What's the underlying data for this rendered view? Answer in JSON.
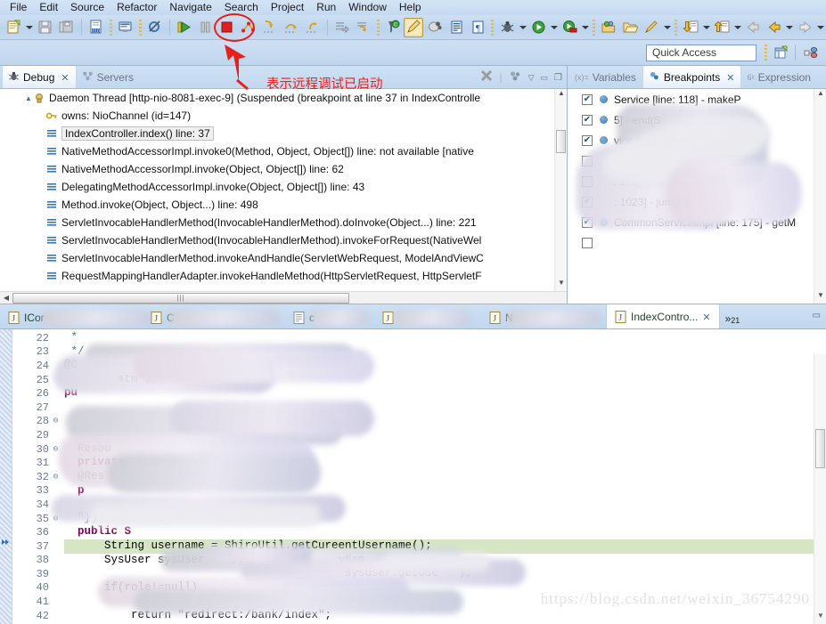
{
  "menu": {
    "items": [
      "File",
      "Edit",
      "Source",
      "Refactor",
      "Navigate",
      "Search",
      "Project",
      "Run",
      "Window",
      "Help"
    ]
  },
  "toolbar": {
    "icons": [
      "new-file-icon",
      "new-dropdown-arrow",
      "save-icon",
      "save-all-icon",
      "toggle-breakpoint-010-icon",
      "console-icon",
      "skip-all-breakpoints-icon",
      "resume-icon",
      "suspend-icon",
      "terminate-icon",
      "disconnect-icon",
      "step-into-icon",
      "step-over-icon",
      "step-return-icon",
      "run-to-line-icon",
      "drop-to-frame-icon",
      "use-step-filters-icon",
      "pencil-edit-icon",
      "toggle-mark-occurrences-icon",
      "show-whitespace-icon",
      "pilcrow-icon",
      "debug-icon",
      "debug-dropdown-arrow",
      "run-icon",
      "run-dropdown-arrow",
      "run-as-coverage-icon",
      "coverage-dropdown-arrow",
      "new-java-package-icon",
      "open-folder-icon",
      "external-tools-icon",
      "external-tools-dropdown-arrow",
      "previous-annotation-icon",
      "previous-dropdown-arrow",
      "next-annotation-icon",
      "next-dropdown-arrow",
      "back-icon",
      "back-highlight-icon",
      "back-dropdown-arrow",
      "forward-icon",
      "forward-dropdown-arrow"
    ],
    "quick_access_placeholder": "Quick Access",
    "perspective_icons": [
      "open-perspective-icon",
      "java-perspective-icon"
    ]
  },
  "debug_view": {
    "tabs": [
      {
        "label": "Debug",
        "icon": "bug-icon",
        "active": true,
        "closable": true
      },
      {
        "label": "Servers",
        "icon": "servers-icon",
        "active": false,
        "closable": false
      }
    ],
    "toolbar_icons": [
      "remove-all-terminated-icon",
      "view-menu-icon",
      "minimize-icon",
      "maximize-icon"
    ],
    "tree": [
      {
        "indent": 1,
        "twisty": "▲",
        "icon": "thread-icon",
        "label": "Daemon Thread [http-nio-8081-exec-9] (Suspended (breakpoint at line 37 in IndexControlle",
        "selected": false
      },
      {
        "indent": 2,
        "twisty": "",
        "icon": "monitor-owns-icon",
        "label": "owns: NioChannel  (id=147)",
        "selected": false
      },
      {
        "indent": 2,
        "twisty": "",
        "icon": "stack-frame-icon",
        "label": "IndexController.index() line: 37",
        "selected": true
      },
      {
        "indent": 2,
        "twisty": "",
        "icon": "stack-frame-icon",
        "label": "NativeMethodAccessorImpl.invoke0(Method, Object, Object[]) line: not available [native",
        "selected": false
      },
      {
        "indent": 2,
        "twisty": "",
        "icon": "stack-frame-icon",
        "label": "NativeMethodAccessorImpl.invoke(Object, Object[]) line: 62",
        "selected": false
      },
      {
        "indent": 2,
        "twisty": "",
        "icon": "stack-frame-icon",
        "label": "DelegatingMethodAccessorImpl.invoke(Object, Object[]) line: 43",
        "selected": false
      },
      {
        "indent": 2,
        "twisty": "",
        "icon": "stack-frame-icon",
        "label": "Method.invoke(Object, Object...) line: 498",
        "selected": false
      },
      {
        "indent": 2,
        "twisty": "",
        "icon": "stack-frame-icon",
        "label": "ServletInvocableHandlerMethod(InvocableHandlerMethod).doInvoke(Object...) line: 221",
        "selected": false
      },
      {
        "indent": 2,
        "twisty": "",
        "icon": "stack-frame-icon",
        "label": "ServletInvocableHandlerMethod(InvocableHandlerMethod).invokeForRequest(NativeWel",
        "selected": false
      },
      {
        "indent": 2,
        "twisty": "",
        "icon": "stack-frame-icon",
        "label": "ServletInvocableHandlerMethod.invokeAndHandle(ServletWebRequest, ModelAndViewC",
        "selected": false
      },
      {
        "indent": 2,
        "twisty": "",
        "icon": "stack-frame-icon",
        "label": "RequestMappingHandlerAdapter.invokeHandleMethod(HttpServletRequest, HttpServletF",
        "selected": false
      }
    ]
  },
  "right_view": {
    "tabs": [
      {
        "label": "Variables",
        "icon": "variables-icon",
        "active": false,
        "closable": false
      },
      {
        "label": "Breakpoints",
        "icon": "breakpoints-icon",
        "active": true,
        "closable": true
      },
      {
        "label": "Expression",
        "icon": "expressions-icon",
        "active": false,
        "closable": false
      }
    ],
    "breakpoints": [
      {
        "checked": true,
        "dot": true,
        "label": "Service [line: 118] - makeP",
        "blurred_prefix": true
      },
      {
        "checked": true,
        "dot": true,
        "label": "5] - end(S",
        "blurred_prefix": true
      },
      {
        "checked": true,
        "dot": true,
        "label": "vice [li - endTask",
        "blurred_prefix": true
      },
      {
        "checked": false,
        "dot": false,
        "label": "] - endTask",
        "blurred_prefix": true
      },
      {
        "checked": false,
        "dot": false,
        "label": ": 189] - complet",
        "blurred_prefix": true
      },
      {
        "checked": true,
        "dot": false,
        "label": ": 1023] - jumpTask",
        "blurred_prefix": true
      },
      {
        "checked": true,
        "dot": true,
        "label": "CommonServiceImpl [line: 175] - getM",
        "blurred_prefix": false
      },
      {
        "checked": false,
        "dot": false,
        "label": "",
        "blurred_prefix": true
      }
    ]
  },
  "editor": {
    "tabs": [
      {
        "label": "ICor",
        "icon": "java-file-icon",
        "active": false,
        "blurred": true
      },
      {
        "label": "C",
        "icon": "java-file-icon",
        "active": false,
        "blurred": true
      },
      {
        "label": "c",
        "icon": "xml-file-icon",
        "active": false,
        "blurred": true
      },
      {
        "label": "",
        "icon": "java-file-icon",
        "active": false,
        "blurred": true
      },
      {
        "label": "N",
        "icon": "java-file-icon",
        "active": false,
        "blurred": true
      },
      {
        "label": "IndexContro...",
        "icon": "java-file-icon",
        "active": true,
        "blurred": false
      }
    ],
    "more_tabs_symbol": "»",
    "more_tabs_count": "21",
    "minimize_icon": "minimize-icon",
    "lines": [
      {
        "n": 22,
        "fold": "",
        "text": " *",
        "cls": "cmt",
        "current": false
      },
      {
        "n": 23,
        "fold": "",
        "text": " */",
        "cls": "cmt",
        "current": false
      },
      {
        "n": 24,
        "fold": "",
        "text": "@C",
        "cls": "ann",
        "current": false
      },
      {
        "n": 25,
        "fold": "",
        "text": "        stm\")",
        "cls": "ann",
        "current": false
      },
      {
        "n": 26,
        "fold": "",
        "text": "pu",
        "cls": "kw",
        "current": false
      },
      {
        "n": 27,
        "fold": "",
        "text": "",
        "cls": "",
        "current": false
      },
      {
        "n": 28,
        "fold": "⊖",
        "text": "",
        "cls": "",
        "current": false
      },
      {
        "n": 29,
        "fold": "",
        "text": "",
        "cls": "",
        "current": false
      },
      {
        "n": 30,
        "fold": "⊖",
        "text": "  Resou",
        "cls": "ann",
        "current": false
      },
      {
        "n": 31,
        "fold": "",
        "text": "  private  ysUser",
        "cls": "kw",
        "current": false
      },
      {
        "n": 32,
        "fold": "⊖",
        "text": "  @Res",
        "cls": "ann",
        "current": false
      },
      {
        "n": 33,
        "fold": "",
        "text": "  p",
        "cls": "kw",
        "current": false
      },
      {
        "n": 34,
        "fold": "",
        "text": "",
        "cls": "",
        "current": false
      },
      {
        "n": 35,
        "fold": "⊖",
        "text": "  \"})",
        "cls": "ann",
        "current": false
      },
      {
        "n": 36,
        "fold": "",
        "text": "  public S",
        "cls": "kw",
        "current": false
      },
      {
        "n": 37,
        "fold": "",
        "text": "      String username = ShiroUtil.getCureentUsername();",
        "cls": "",
        "current": true
      },
      {
        "n": 38,
        "fold": "",
        "text": "      SysUser sysUser =  sysUserS        yNam",
        "cls": "",
        "current": false
      },
      {
        "n": 39,
        "fold": "",
        "text": "                                          sysUser.getUse   );",
        "cls": "",
        "current": false
      },
      {
        "n": 40,
        "fold": "",
        "text": "      if(role!=null)",
        "cls": "",
        "current": false
      },
      {
        "n": 41,
        "fold": "",
        "text": "",
        "cls": "",
        "current": false
      },
      {
        "n": 42,
        "fold": "",
        "text": "          return \"redirect:/bank/index\";",
        "cls": "",
        "current": false
      }
    ],
    "current_line_number": 37,
    "watermark": "https://blog.csdn.net/weixin_36754290"
  },
  "annotation": {
    "text": "表示远程调试已启动",
    "color": "#e8201c",
    "circle_target": "disconnect-icon",
    "arrow": "red-arrow"
  },
  "colors": {
    "chrome_blue": "#c3d9f0",
    "accent_red": "#e8201c",
    "current_line_green": "#d6e6c4",
    "selection_grey": "#f0f0f0"
  }
}
